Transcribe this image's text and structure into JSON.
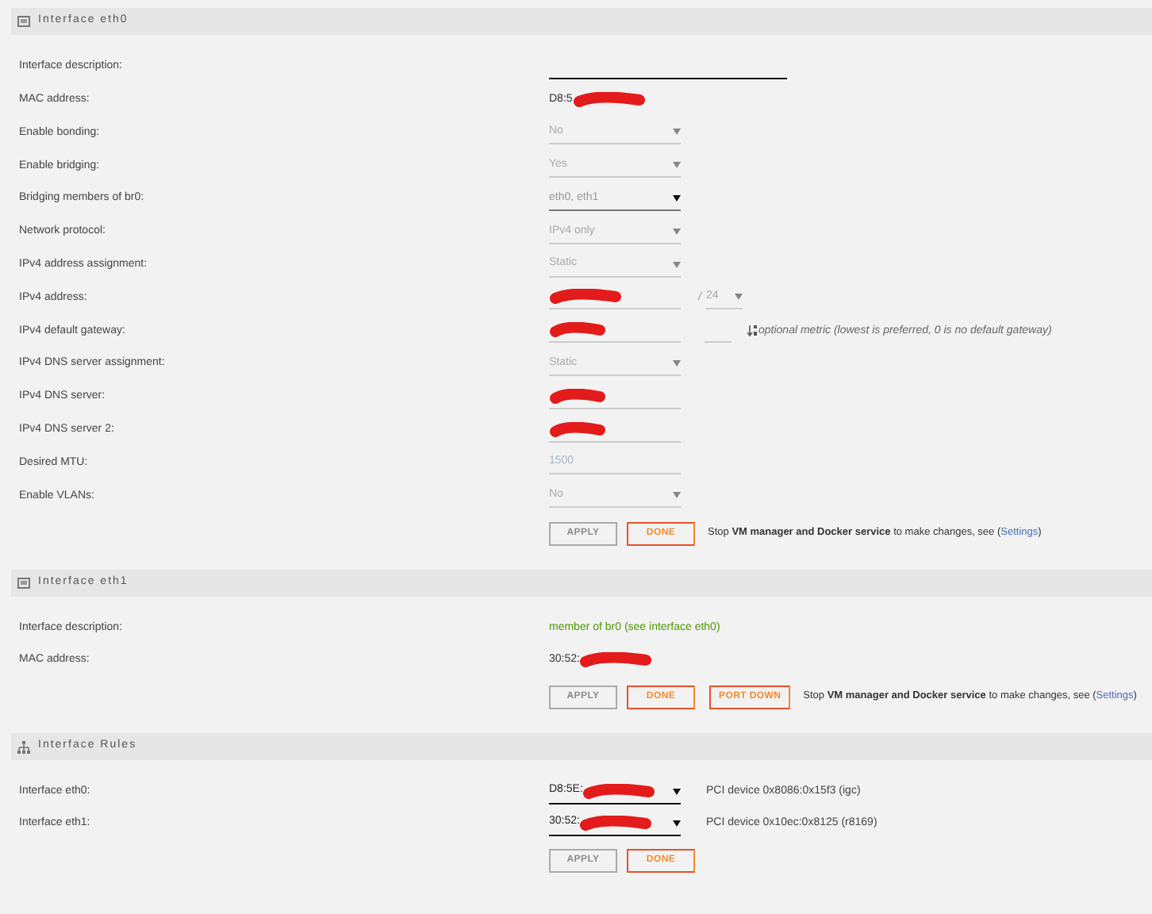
{
  "sections": [
    {
      "title": "Interface eth0",
      "kind": "interface",
      "rows": [
        {
          "label": "Interface description:",
          "kind": "wide-input"
        },
        {
          "label": "MAC address:",
          "kind": "text",
          "value": "D8:5",
          "redacted": true
        },
        {
          "label": "Enable bonding:",
          "kind": "select",
          "value": "No",
          "disabled": true
        },
        {
          "label": "Enable bridging:",
          "kind": "select",
          "value": "Yes",
          "disabled": true
        },
        {
          "label": "Bridging members of br0:",
          "kind": "select",
          "value": "eth0, eth1",
          "disabled": false
        },
        {
          "label": "Network protocol:",
          "kind": "select",
          "value": "IPv4 only",
          "disabled": true
        },
        {
          "label": "IPv4 address assignment:",
          "kind": "select",
          "value": "Static",
          "disabled": true
        },
        {
          "label": "IPv4 address:",
          "kind": "input",
          "redacted": true,
          "mask": {
            "slash": "/",
            "value": "24"
          }
        },
        {
          "label": "IPv4 default gateway:",
          "kind": "input",
          "redacted": true,
          "metric": {
            "hint": "optional metric (lowest is preferred, 0 is no default gateway)"
          }
        },
        {
          "label": "IPv4 DNS server assignment:",
          "kind": "select",
          "value": "Static",
          "disabled": true
        },
        {
          "label": "IPv4 DNS server:",
          "kind": "input",
          "redacted": true
        },
        {
          "label": "IPv4 DNS server 2:",
          "kind": "input",
          "redacted": true
        },
        {
          "label": "Desired MTU:",
          "kind": "input",
          "placeholder": "1500"
        },
        {
          "label": "Enable VLANs:",
          "kind": "select",
          "value": "No",
          "disabled": true
        }
      ],
      "buttons": [
        {
          "label": "APPLY",
          "disabled": true
        },
        {
          "label": "DONE",
          "disabled": false
        }
      ],
      "note": {
        "text": "Stop **VM manager and Docker service** to make changes, see (",
        "link": "Settings",
        "end": ")"
      }
    },
    {
      "title": "Interface eth1",
      "kind": "interface",
      "rows": [
        {
          "label": "Interface description:",
          "kind": "note",
          "value": "member of br0 (see interface eth0)"
        },
        {
          "label": "MAC address:",
          "kind": "text",
          "value": "30:52:",
          "redacted": true
        }
      ],
      "buttons": [
        {
          "label": "APPLY",
          "disabled": true
        },
        {
          "label": "DONE",
          "disabled": false
        },
        {
          "label": "PORT DOWN",
          "disabled": false
        }
      ],
      "note": {
        "text": "Stop **VM manager and Docker service** to make changes, see (",
        "link": "Settings",
        "end": ")"
      }
    },
    {
      "title": "Interface Rules",
      "kind": "rules",
      "rows": [
        {
          "label": "Interface eth0:",
          "kind": "rule",
          "value": "D8:5E:",
          "redacted": true,
          "info": "PCI device 0x8086:0x15f3 (igc)"
        },
        {
          "label": "Interface eth1:",
          "kind": "rule",
          "value": "30:52:",
          "redacted": true,
          "info": "PCI device 0x10ec:0x8125 (r8169)"
        }
      ],
      "buttons": [
        {
          "label": "APPLY",
          "disabled": true
        },
        {
          "label": "DONE",
          "disabled": false
        }
      ]
    }
  ]
}
